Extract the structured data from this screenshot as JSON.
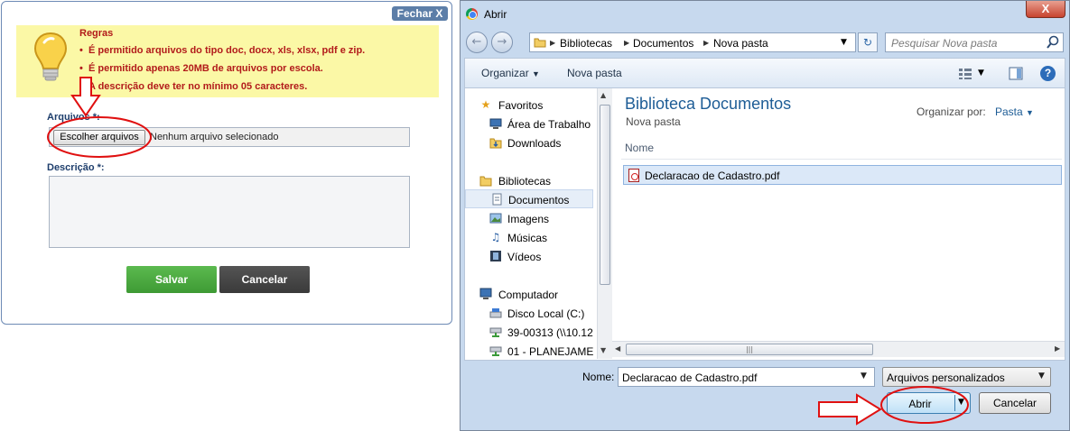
{
  "web_form": {
    "close_label": "Fechar X",
    "rules_title": "Regras",
    "rules": [
      "É permitido arquivos do tipo doc, docx, xls, xlsx, pdf e zip.",
      "É permitido apenas 20MB de arquivos por escola.",
      "A descrição deve ter no mínimo 05 caracteres."
    ],
    "files_label": "Arquivos *:",
    "choose_files_label": "Escolher arquivos",
    "no_file_text": "Nenhum arquivo selecionado",
    "description_label": "Descrição *:",
    "description_value": "",
    "save_label": "Salvar",
    "cancel_label": "Cancelar"
  },
  "dialog": {
    "title": "Abrir",
    "close_glyph": "X",
    "breadcrumb": [
      "Bibliotecas",
      "Documentos",
      "Nova pasta"
    ],
    "search_placeholder": "Pesquisar Nova pasta",
    "toolbar": {
      "organize": "Organizar",
      "new_folder": "Nova pasta"
    },
    "nav": {
      "favorites": "Favoritos",
      "favorites_items": [
        "Área de Trabalho",
        "Downloads"
      ],
      "libraries": "Bibliotecas",
      "libraries_items": [
        "Documentos",
        "Imagens",
        "Músicas",
        "Vídeos"
      ],
      "selected": "Documentos",
      "computer": "Computador",
      "computer_items": [
        "Disco Local (C:)",
        "39-00313 (\\\\10.12",
        "01 - PLANEJAME"
      ]
    },
    "content": {
      "library_title": "Biblioteca Documentos",
      "library_subtitle": "Nova pasta",
      "arrange_label": "Organizar por:",
      "arrange_value": "Pasta",
      "column_name": "Nome",
      "files": [
        "Declaracao de Cadastro.pdf"
      ]
    },
    "footer": {
      "name_label": "Nome:",
      "name_value": "Declaracao de Cadastro.pdf",
      "filter_value": "Arquivos personalizados",
      "open_label": "Abrir",
      "cancel_label": "Cancelar"
    }
  },
  "colors": {
    "rules_bg": "#fbf8a6",
    "rules_text": "#b21b1b",
    "annotation_red": "#e01010",
    "save_green": "#46a53b",
    "lib_title_blue": "#1e5d96"
  }
}
